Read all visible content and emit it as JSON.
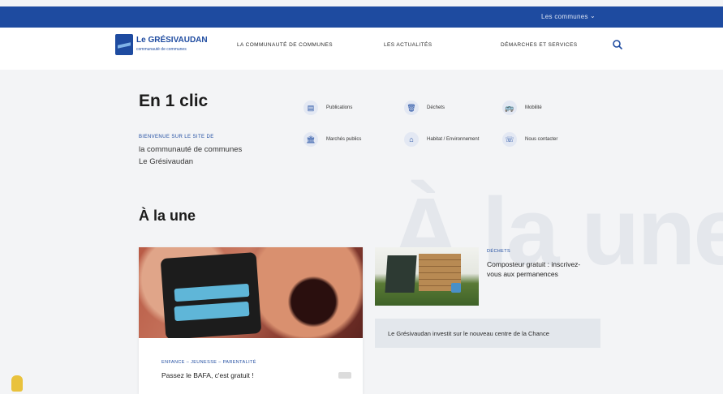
{
  "topbar": {
    "communes_label": "Les communes",
    "chevron_icon": "chevron-down-icon"
  },
  "header": {
    "logo_name": "Le GRÉSIVAUDAN",
    "logo_sub": "communauté de communes",
    "nav": [
      "LA COMMUNAUTÉ DE COMMUNES",
      "LES ACTUALITÉS",
      "DÉMARCHES ET SERVICES"
    ],
    "search_icon": "search-icon"
  },
  "clic": {
    "heading": "En 1 clic",
    "kicker": "BIENVENUE SUR LE SITE DE",
    "description": "la communauté de communes Le Grésivaudan",
    "items": [
      {
        "icon": "document-icon",
        "glyph": "▤",
        "label": "Publications"
      },
      {
        "icon": "trash-icon",
        "glyph": "🗑",
        "label": "Déchets"
      },
      {
        "icon": "bus-icon",
        "glyph": "🚌",
        "label": "Mobilité"
      },
      {
        "icon": "building-icon",
        "glyph": "🏛",
        "label": "Marchés publics"
      },
      {
        "icon": "home-icon",
        "glyph": "⌂",
        "label": "Habitat / Environnement"
      },
      {
        "icon": "contact-icon",
        "glyph": "☏",
        "label": "Nous contacter"
      }
    ]
  },
  "une": {
    "heading": "À la une",
    "watermark": "À la une",
    "card1": {
      "category": "ENFANCE – JEUNESSE – PARENTALITÉ",
      "title": "Passez le BAFA, c'est gratuit !"
    },
    "card2": {
      "category": "DÉCHETS",
      "title": "Composteur gratuit : inscrivez-vous aux permanences"
    },
    "card3": {
      "title": "Le Grésivaudan investit sur le nouveau centre de la Chance"
    }
  }
}
